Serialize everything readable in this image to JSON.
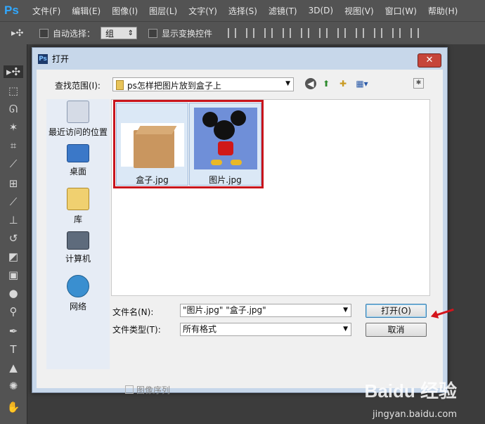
{
  "app": {
    "logo": "Ps"
  },
  "menu": [
    "文件(F)",
    "编辑(E)",
    "图像(I)",
    "图层(L)",
    "文字(Y)",
    "选择(S)",
    "滤镜(T)",
    "3D(D)",
    "视图(V)",
    "窗口(W)",
    "帮助(H)"
  ],
  "options_bar": {
    "auto_select_label": "自动选择：",
    "auto_select_value": "组",
    "show_transform_label": "显示变换控件"
  },
  "dialog": {
    "title": "打开",
    "close_glyph": "✕",
    "look_in_label": "查找范围(I):",
    "look_in_value": "ps怎样把图片放到盒子上",
    "places": [
      "最近访问的位置",
      "桌面",
      "库",
      "计算机",
      "网络"
    ],
    "files": [
      {
        "name": "盒子.jpg"
      },
      {
        "name": "图片.jpg"
      }
    ],
    "filename_label": "文件名(N):",
    "filename_value": "\"图片.jpg\" \"盒子.jpg\"",
    "filetype_label": "文件类型(T):",
    "filetype_value": "所有格式",
    "open_button": "打开(O)",
    "cancel_button": "取消",
    "image_sequence_label": "图像序列"
  },
  "watermark": {
    "brand": "Baidu 经验",
    "url": "jingyan.baidu.com"
  }
}
